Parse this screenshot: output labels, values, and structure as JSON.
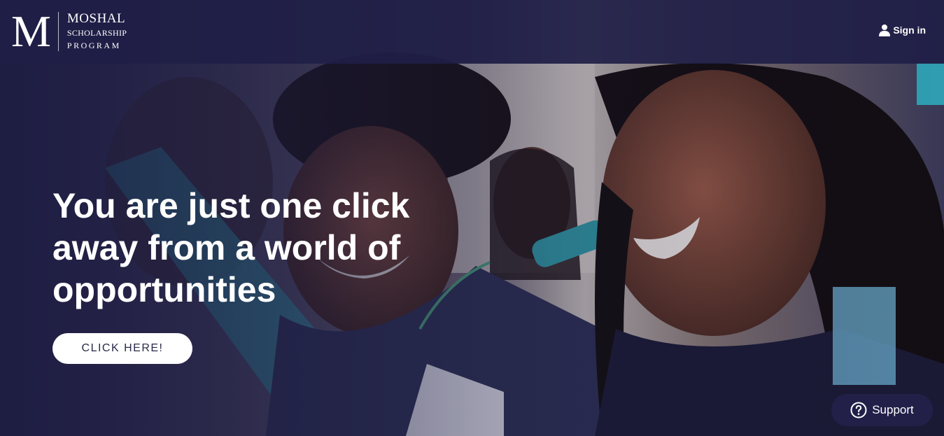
{
  "header": {
    "logo": {
      "mark": "M",
      "line1": "MOSHAL",
      "line2": "SCHOLARSHIP",
      "line3": "PROGRAM"
    },
    "signin_label": "Sign in",
    "signin_icon": "user-icon"
  },
  "hero": {
    "title_line1": "You are just one click",
    "title_line2": "away from a world of",
    "title_line3": "opportunities",
    "cta_label": "CLICK HERE!",
    "image_subject": "students smiling"
  },
  "support": {
    "label": "Support",
    "icon": "help-circle-icon"
  },
  "colors": {
    "header_bg": "#1f1e46",
    "overlay": "#1c1b40",
    "cta_bg": "#ffffff",
    "cta_text": "#2a2a4a",
    "support_bg": "#222048"
  }
}
